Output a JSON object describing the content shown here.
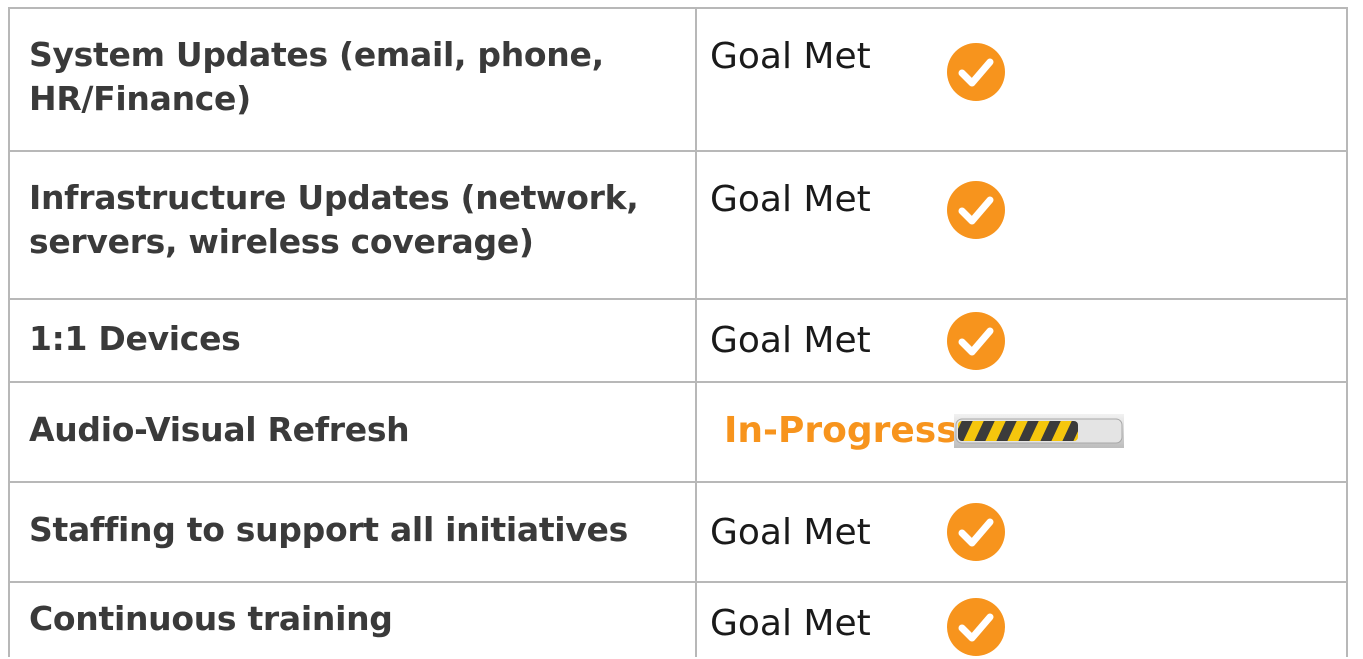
{
  "rows": [
    {
      "task": "System Updates (email, phone, HR/Finance)",
      "status": "Goal Met",
      "status_type": "goal-met",
      "icon": "check-circle-icon"
    },
    {
      "task": "Infrastructure Updates (network, servers, wireless coverage)",
      "status": "Goal Met",
      "status_type": "goal-met",
      "icon": "check-circle-icon"
    },
    {
      "task": "1:1 Devices",
      "status": "Goal Met",
      "status_type": "goal-met",
      "icon": "check-circle-icon"
    },
    {
      "task": "Audio-Visual Refresh",
      "status": "In-Progress",
      "status_type": "in-progress",
      "icon": "progress-bar-icon",
      "progress": 0.8
    },
    {
      "task": "Staffing to support all initiatives",
      "status": "Goal Met",
      "status_type": "goal-met",
      "icon": "check-circle-icon"
    },
    {
      "task": "Continuous training",
      "status": "Goal Met",
      "status_type": "goal-met",
      "icon": "check-circle-icon"
    }
  ],
  "colors": {
    "accent": "#f7941d",
    "text": "#3a3a3a",
    "grid": "#b8b8b8"
  }
}
